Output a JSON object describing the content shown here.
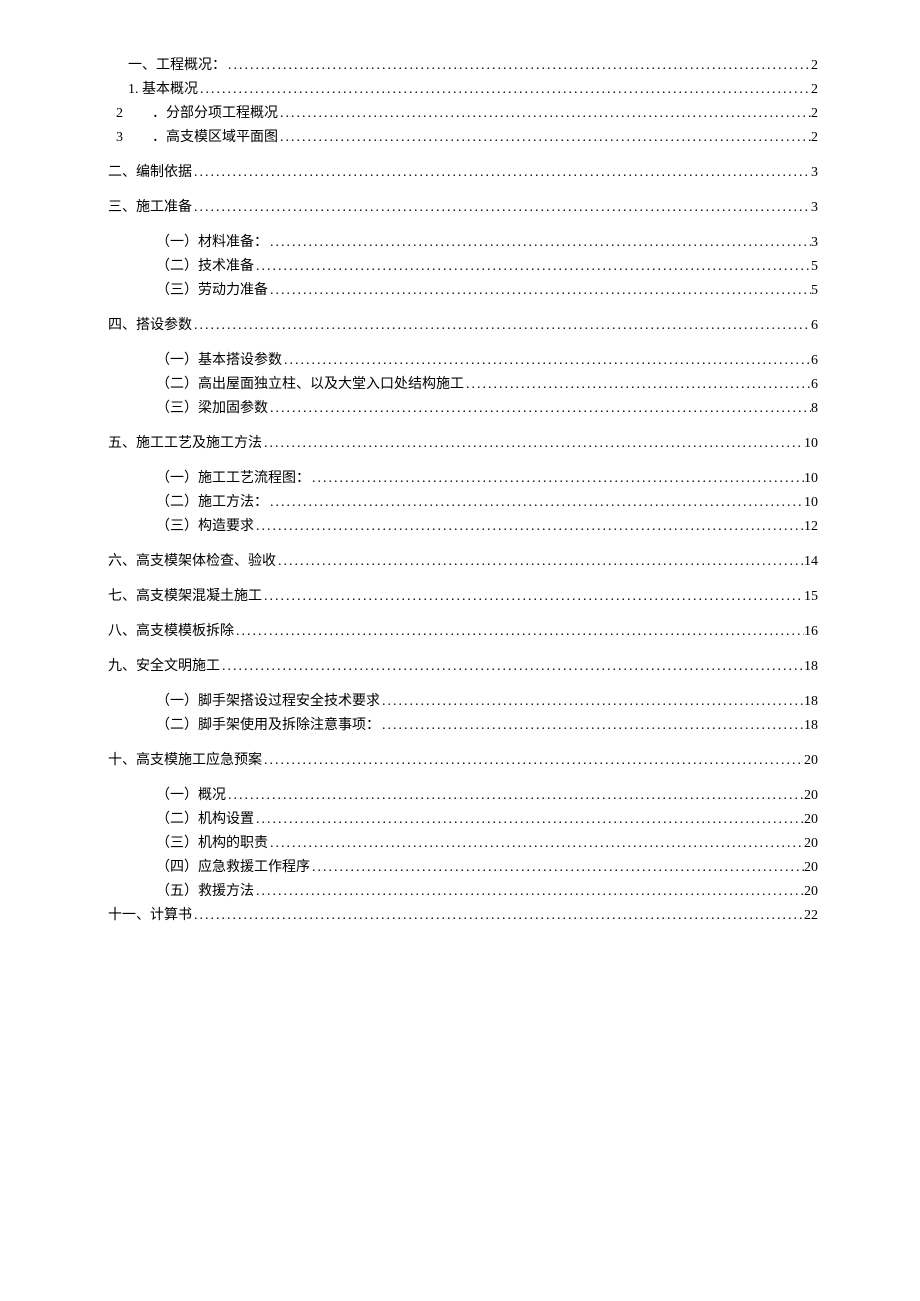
{
  "dots": "............................................................................................................................................................................",
  "toc": [
    {
      "label": "一、工程概况：",
      "page": "2",
      "indent": "indent-1",
      "gap": false
    },
    {
      "label": "1. 基本概况",
      "page": "2",
      "indent": "indent-1",
      "gap": false
    },
    {
      "labelPrefix": "2",
      "label": "．分部分项工程概况",
      "page": "2",
      "indent": "indent-3a",
      "gap": false,
      "num": true
    },
    {
      "labelPrefix": "3",
      "label": "．高支模区域平面图",
      "page": "2",
      "indent": "indent-3a",
      "gap": false,
      "num": true
    },
    {
      "label": "二、编制依据",
      "page": "3",
      "indent": "indent-3b",
      "gap": true
    },
    {
      "label": "三、施工准备",
      "page": "3",
      "indent": "indent-3b",
      "gap": true
    },
    {
      "label": "（一）材料准备：",
      "page": "3",
      "indent": "indent-2",
      "gap": true
    },
    {
      "label": "（二）技术准备",
      "page": "5",
      "indent": "indent-2",
      "gap": false
    },
    {
      "label": "（三）劳动力准备",
      "page": "5",
      "indent": "indent-2",
      "gap": false
    },
    {
      "label": "四、搭设参数",
      "page": "6",
      "indent": "indent-3b",
      "gap": true
    },
    {
      "label": "（一）基本搭设参数",
      "page": "6",
      "indent": "indent-2",
      "gap": true
    },
    {
      "label": "（二）高出屋面独立柱、以及大堂入口处结构施工",
      "page": "6",
      "indent": "indent-2",
      "gap": false
    },
    {
      "label": "（三）梁加固参数",
      "page": "8",
      "indent": "indent-2",
      "gap": false
    },
    {
      "label": "五、施工工艺及施工方法",
      "page": "10",
      "indent": "indent-3b",
      "gap": true
    },
    {
      "label": "（一）施工工艺流程图：",
      "page": "10",
      "indent": "indent-2",
      "gap": true
    },
    {
      "label": "（二）施工方法：",
      "page": "10",
      "indent": "indent-2",
      "gap": false
    },
    {
      "label": "（三）构造要求",
      "page": "12",
      "indent": "indent-2",
      "gap": false
    },
    {
      "label": "六、高支模架体检查、验收",
      "page": "14",
      "indent": "indent-3b",
      "gap": true
    },
    {
      "label": "七、高支模架混凝土施工",
      "page": "15",
      "indent": "indent-3b",
      "gap": true
    },
    {
      "label": "八、高支模模板拆除",
      "page": "16",
      "indent": "indent-3b",
      "gap": true
    },
    {
      "label": "九、安全文明施工",
      "page": "18",
      "indent": "indent-3b",
      "gap": true
    },
    {
      "label": "（一）脚手架搭设过程安全技术要求",
      "page": "18",
      "indent": "indent-2",
      "gap": true
    },
    {
      "label": "（二）脚手架使用及拆除注意事项：",
      "page": "18",
      "indent": "indent-2",
      "gap": false
    },
    {
      "label": "十、高支模施工应急预案",
      "page": "20",
      "indent": "indent-3b",
      "gap": true
    },
    {
      "label": "（一）概况",
      "page": "20",
      "indent": "indent-2",
      "gap": true
    },
    {
      "label": "（二）机构设置",
      "page": "20",
      "indent": "indent-2",
      "gap": false
    },
    {
      "label": "（三）机构的职责",
      "page": "20",
      "indent": "indent-2",
      "gap": false
    },
    {
      "label": "（四）应急救援工作程序",
      "page": "20",
      "indent": "indent-2",
      "gap": false
    },
    {
      "label": "（五）救援方法",
      "page": "20",
      "indent": "indent-2",
      "gap": false
    },
    {
      "label": "十一、计算书",
      "page": "22",
      "indent": "indent-3b",
      "gap": false
    }
  ]
}
